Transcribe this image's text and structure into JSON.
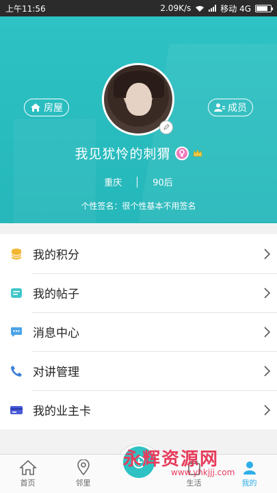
{
  "status_bar": {
    "time": "上午11:56",
    "speed": "2.09K/s",
    "carrier": "移动 4G",
    "battery_level": 0.8
  },
  "profile": {
    "house_label": "房屋",
    "member_label": "成员",
    "nickname": "我见犹怜的刺猬",
    "city": "重庆",
    "age_group": "90后",
    "signature": "个性签名：很个性基本不用签名",
    "colors": {
      "header_bg": "#2ec2c4",
      "gender_badge": "#f07bbd",
      "vip_badge": "#f2c94c"
    }
  },
  "menu": {
    "items": [
      {
        "label": "我的积分",
        "icon": "coins-icon",
        "color": "#f2b632"
      },
      {
        "label": "我的帖子",
        "icon": "post-icon",
        "color": "#3ec6c9"
      },
      {
        "label": "消息中心",
        "icon": "message-icon",
        "color": "#4aa3e8"
      },
      {
        "label": "对讲管理",
        "icon": "phone-icon",
        "color": "#3f7fd8"
      },
      {
        "label": "我的业主卡",
        "icon": "card-icon",
        "color": "#4a5bd6"
      }
    ]
  },
  "bottom_nav": {
    "items": [
      {
        "label": "首页",
        "icon": "home-icon"
      },
      {
        "label": "邻里",
        "icon": "location-icon"
      },
      {
        "label": "",
        "icon": "center-action-icon"
      },
      {
        "label": "生活",
        "icon": "life-icon"
      },
      {
        "label": "我的",
        "icon": "user-icon"
      }
    ],
    "active_color": "#2eaee8"
  },
  "watermark": {
    "main": "永辉资源网",
    "sub": "www.yhkjjj.com"
  }
}
